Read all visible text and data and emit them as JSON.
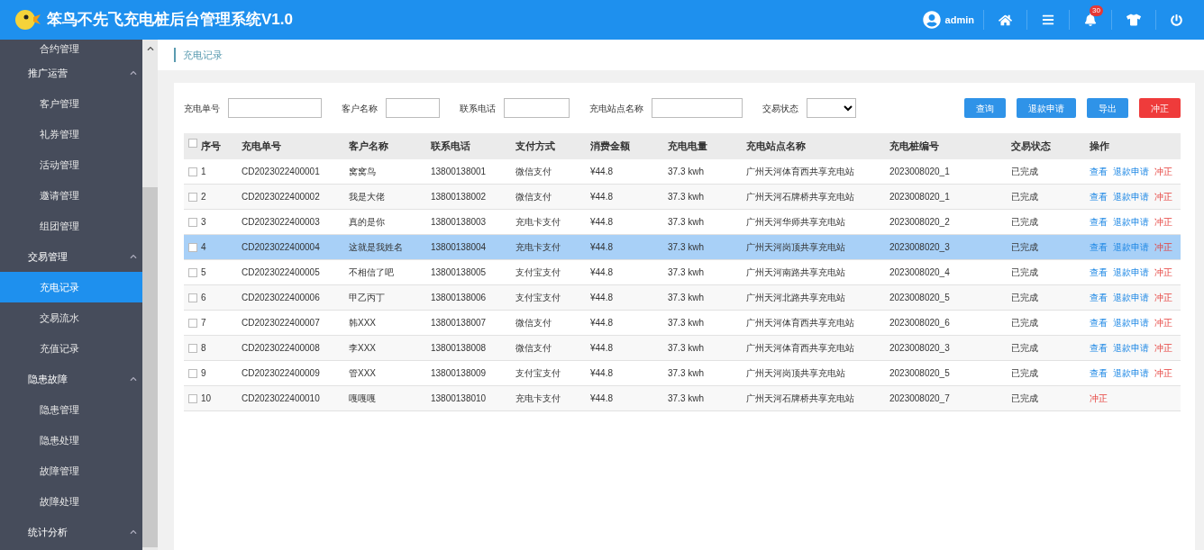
{
  "header": {
    "title": "笨鸟不先飞充电桩后台管理系统V1.0",
    "user": "admin",
    "notification_count": "30"
  },
  "sidebar": {
    "items": [
      {
        "kind": "sub",
        "label": "合约管理",
        "selected": false
      },
      {
        "kind": "group",
        "label": "推广运营",
        "expanded": true
      },
      {
        "kind": "sub",
        "label": "客户管理",
        "selected": false
      },
      {
        "kind": "sub",
        "label": "礼券管理",
        "selected": false
      },
      {
        "kind": "sub",
        "label": "活动管理",
        "selected": false
      },
      {
        "kind": "sub",
        "label": "邀请管理",
        "selected": false
      },
      {
        "kind": "sub",
        "label": "组团管理",
        "selected": false
      },
      {
        "kind": "group",
        "label": "交易管理",
        "expanded": true
      },
      {
        "kind": "sub",
        "label": "充电记录",
        "selected": true
      },
      {
        "kind": "sub",
        "label": "交易流水",
        "selected": false
      },
      {
        "kind": "sub",
        "label": "充值记录",
        "selected": false
      },
      {
        "kind": "group",
        "label": "隐患故障",
        "expanded": true
      },
      {
        "kind": "sub",
        "label": "隐患管理",
        "selected": false
      },
      {
        "kind": "sub",
        "label": "隐患处理",
        "selected": false
      },
      {
        "kind": "sub",
        "label": "故障管理",
        "selected": false
      },
      {
        "kind": "sub",
        "label": "故障处理",
        "selected": false
      },
      {
        "kind": "group",
        "label": "统计分析",
        "expanded": true
      }
    ]
  },
  "breadcrumb": "充电记录",
  "filters": [
    {
      "kind": "text",
      "label": "充电单号"
    },
    {
      "kind": "text",
      "label": "客户名称"
    },
    {
      "kind": "text",
      "label": "联系电话"
    },
    {
      "kind": "text",
      "label": "充电站点名称"
    },
    {
      "kind": "select",
      "label": "交易状态"
    }
  ],
  "buttons": [
    {
      "label": "查询",
      "kind": "primary"
    },
    {
      "label": "退款申请",
      "kind": "primary"
    },
    {
      "label": "导出",
      "kind": "primary"
    },
    {
      "label": "冲正",
      "kind": "danger"
    }
  ],
  "table": {
    "header_checked": false,
    "columns": [
      "序号",
      "充电单号",
      "客户名称",
      "联系电话",
      "支付方式",
      "消费金额",
      "充电电量",
      "充电站点名称",
      "充电桩编号",
      "交易状态",
      "操作"
    ],
    "rows": [
      {
        "selected": false,
        "checked": false,
        "cells": [
          "1",
          "CD2023022400001",
          "窝窝鸟",
          "13800138001",
          "微信支付",
          "¥44.8",
          "37.3 kwh",
          "广州天河体育西共享充电站",
          "2023008020_1",
          "已完成"
        ],
        "actions": [
          {
            "label": "查看",
            "kind": "link"
          },
          {
            "label": "退款申请",
            "kind": "link"
          },
          {
            "label": "冲正",
            "kind": "danger"
          }
        ]
      },
      {
        "selected": false,
        "checked": false,
        "cells": [
          "2",
          "CD2023022400002",
          "我是大佬",
          "13800138002",
          "微信支付",
          "¥44.8",
          "37.3 kwh",
          "广州天河石牌桥共享充电站",
          "2023008020_1",
          "已完成"
        ],
        "actions": [
          {
            "label": "查看",
            "kind": "link"
          },
          {
            "label": "退款申请",
            "kind": "link"
          },
          {
            "label": "冲正",
            "kind": "danger"
          }
        ]
      },
      {
        "selected": false,
        "checked": false,
        "cells": [
          "3",
          "CD2023022400003",
          "真的是你",
          "13800138003",
          "充电卡支付",
          "¥44.8",
          "37.3 kwh",
          "广州天河华师共享充电站",
          "2023008020_2",
          "已完成"
        ],
        "actions": [
          {
            "label": "查看",
            "kind": "link"
          },
          {
            "label": "退款申请",
            "kind": "link"
          },
          {
            "label": "冲正",
            "kind": "danger"
          }
        ]
      },
      {
        "selected": true,
        "checked": false,
        "cells": [
          "4",
          "CD2023022400004",
          "这就是我姓名",
          "13800138004",
          "充电卡支付",
          "¥44.8",
          "37.3 kwh",
          "广州天河岗顶共享充电站",
          "2023008020_3",
          "已完成"
        ],
        "actions": [
          {
            "label": "查看",
            "kind": "link"
          },
          {
            "label": "退款申请",
            "kind": "link"
          },
          {
            "label": "冲正",
            "kind": "danger"
          }
        ]
      },
      {
        "selected": false,
        "checked": false,
        "cells": [
          "5",
          "CD2023022400005",
          "不相信了吧",
          "13800138005",
          "支付宝支付",
          "¥44.8",
          "37.3 kwh",
          "广州天河南路共享充电站",
          "2023008020_4",
          "已完成"
        ],
        "actions": [
          {
            "label": "查看",
            "kind": "link"
          },
          {
            "label": "退款申请",
            "kind": "link"
          },
          {
            "label": "冲正",
            "kind": "danger"
          }
        ]
      },
      {
        "selected": false,
        "checked": false,
        "cells": [
          "6",
          "CD2023022400006",
          "甲乙丙丁",
          "13800138006",
          "支付宝支付",
          "¥44.8",
          "37.3 kwh",
          "广州天河北路共享充电站",
          "2023008020_5",
          "已完成"
        ],
        "actions": [
          {
            "label": "查看",
            "kind": "link"
          },
          {
            "label": "退款申请",
            "kind": "link"
          },
          {
            "label": "冲正",
            "kind": "danger"
          }
        ]
      },
      {
        "selected": false,
        "checked": false,
        "cells": [
          "7",
          "CD2023022400007",
          "韩XXX",
          "13800138007",
          "微信支付",
          "¥44.8",
          "37.3 kwh",
          "广州天河体育西共享充电站",
          "2023008020_6",
          "已完成"
        ],
        "actions": [
          {
            "label": "查看",
            "kind": "link"
          },
          {
            "label": "退款申请",
            "kind": "link"
          },
          {
            "label": "冲正",
            "kind": "danger"
          }
        ]
      },
      {
        "selected": false,
        "checked": false,
        "cells": [
          "8",
          "CD2023022400008",
          "李XXX",
          "13800138008",
          "微信支付",
          "¥44.8",
          "37.3 kwh",
          "广州天河体育西共享充电站",
          "2023008020_3",
          "已完成"
        ],
        "actions": [
          {
            "label": "查看",
            "kind": "link"
          },
          {
            "label": "退款申请",
            "kind": "link"
          },
          {
            "label": "冲正",
            "kind": "danger"
          }
        ]
      },
      {
        "selected": false,
        "checked": false,
        "cells": [
          "9",
          "CD2023022400009",
          "管XXX",
          "13800138009",
          "支付宝支付",
          "¥44.8",
          "37.3 kwh",
          "广州天河岗顶共享充电站",
          "2023008020_5",
          "已完成"
        ],
        "actions": [
          {
            "label": "查看",
            "kind": "link"
          },
          {
            "label": "退款申请",
            "kind": "link"
          },
          {
            "label": "冲正",
            "kind": "danger"
          }
        ]
      },
      {
        "selected": false,
        "checked": false,
        "cells": [
          "10",
          "CD2023022400010",
          "嘎嘎嘎",
          "13800138010",
          "充电卡支付",
          "¥44.8",
          "37.3 kwh",
          "广州天河石牌桥共享充电站",
          "2023008020_7",
          "已完成"
        ],
        "actions": [
          {
            "label": "冲正",
            "kind": "danger"
          }
        ]
      }
    ]
  }
}
